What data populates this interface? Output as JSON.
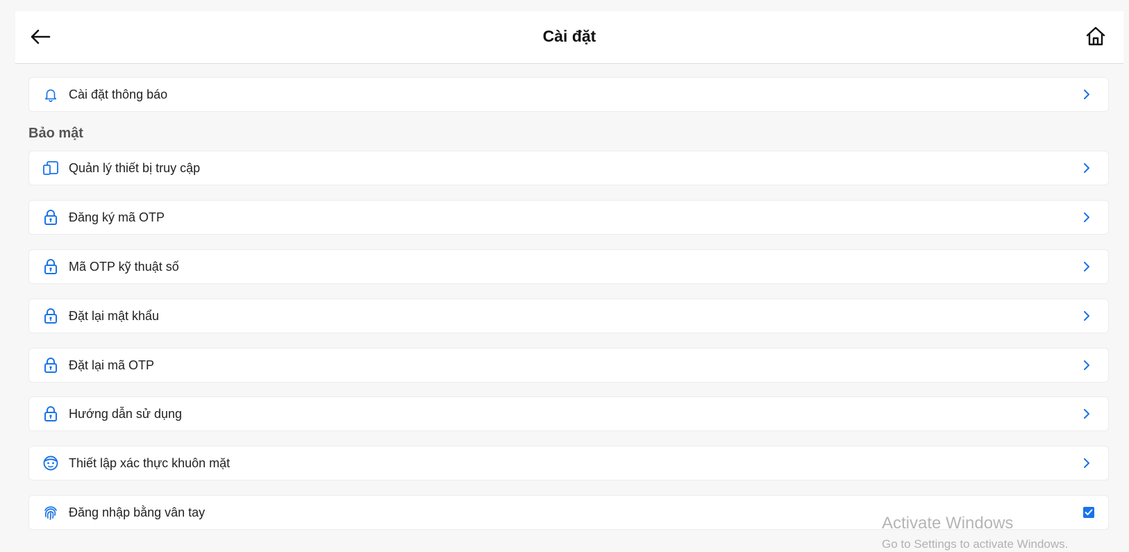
{
  "header": {
    "title": "Cài đặt"
  },
  "notifications_item": {
    "label": "Cài đặt thông báo"
  },
  "security": {
    "section_title": "Bảo mật",
    "items": [
      {
        "label": "Quản lý thiết bị truy cập",
        "icon": "devices-icon"
      },
      {
        "label": "Đăng ký mã OTP",
        "icon": "lock-icon"
      },
      {
        "label": "Mã OTP kỹ thuật số",
        "icon": "lock-icon"
      },
      {
        "label": "Đặt lại mật khẩu",
        "icon": "lock-icon"
      },
      {
        "label": "Đặt lại mã OTP",
        "icon": "lock-icon"
      },
      {
        "label": "Hướng dẫn sử dụng",
        "icon": "lock-icon"
      },
      {
        "label": "Thiết lập xác thực khuôn mặt",
        "icon": "face-icon"
      },
      {
        "label": "Đăng nhập bằng vân tay",
        "icon": "fingerprint-icon",
        "checked": true
      }
    ]
  },
  "watermark": {
    "line1": "Activate Windows",
    "line2": "Go to Settings to activate Windows."
  },
  "colors": {
    "accent": "#1a73e8",
    "background": "#f7f7f7"
  }
}
